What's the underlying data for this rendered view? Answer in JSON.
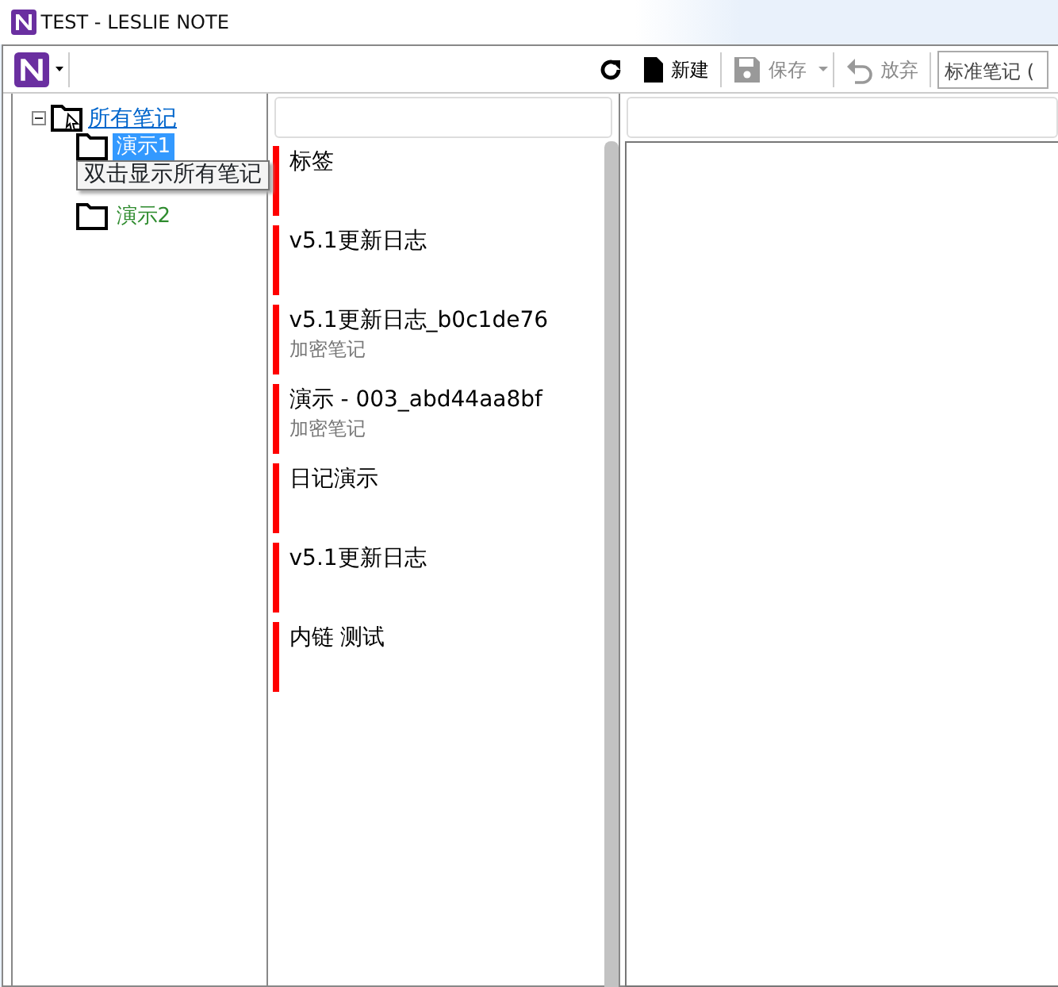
{
  "window": {
    "title": "TEST - LESLIE NOTE"
  },
  "toolbar": {
    "buttons": [
      {
        "kind": "refresh",
        "disabled": false
      },
      {
        "kind": "new",
        "label": "新建",
        "disabled": false
      },
      {
        "kind": "save",
        "label": "保存",
        "disabled": true
      },
      {
        "kind": "discard",
        "label": "放弃",
        "disabled": true
      }
    ],
    "mode_field": {
      "value": "标准笔记 ("
    }
  },
  "tree": {
    "items": [
      {
        "label": "所有笔记",
        "expanded": true,
        "children": [
          {
            "label": "演示1",
            "selected": true
          },
          {
            "label": "演示2",
            "selected": false
          }
        ]
      }
    ]
  },
  "tooltip": "双击显示所有笔记",
  "notes": [
    {
      "title": "标签",
      "color": "#ff0000"
    },
    {
      "title": "v5.1更新日志",
      "color": "#ff0000"
    },
    {
      "title": "v5.1更新日志_b0c1de76",
      "subtitle": "加密笔记",
      "color": "#ff0000"
    },
    {
      "title": "演示 - 003_abd44aa8bf",
      "subtitle": "加密笔记",
      "color": "#ff0000"
    },
    {
      "title": "日记演示",
      "color": "#ff0000"
    },
    {
      "title": "v5.1更新日志",
      "color": "#ff0000"
    },
    {
      "title": "内链 测试",
      "color": "#ff0000"
    }
  ]
}
